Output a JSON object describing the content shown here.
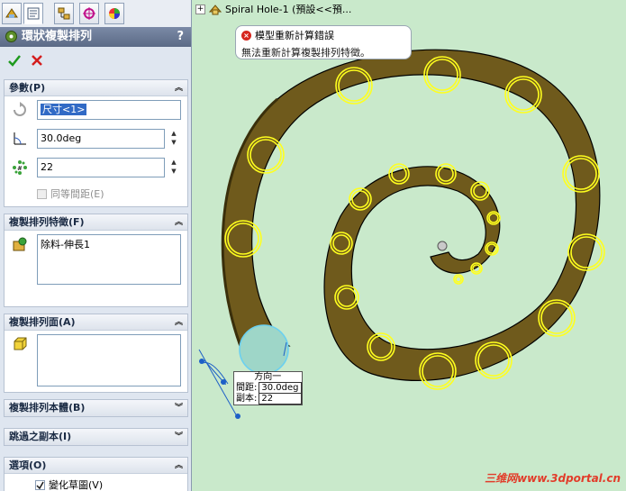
{
  "tabs": [
    {
      "icon": "feature-manager-icon"
    },
    {
      "icon": "property-manager-icon"
    },
    {
      "icon": "configuration-manager-icon"
    },
    {
      "icon": "dimxpert-icon"
    },
    {
      "icon": "display-manager-icon"
    }
  ],
  "panel": {
    "title": "環狀複製排列",
    "help": "?"
  },
  "groups": {
    "parameters": {
      "title": "參數(P)",
      "axis_value": "尺寸<1>",
      "angle_value": "30.0deg",
      "instances_value": "22",
      "equal_spacing_label": "同等間距(E)"
    },
    "features": {
      "title": "複製排列特徵(F)",
      "items": [
        "除料-伸長1"
      ]
    },
    "faces": {
      "title": "複製排列面(A)"
    },
    "bodies": {
      "title": "複製排列本體(B)"
    },
    "skip": {
      "title": "跳過之副本(I)"
    },
    "options": {
      "title": "選項(O)",
      "vary_sketch_label": "變化草圖(V)"
    }
  },
  "graphics": {
    "tree_label": "Spiral Hole-1 (預設<<預...",
    "tooltip_title": "模型重新計算錯誤",
    "tooltip_message": "無法重新計算複製排列特徵。",
    "dim_header": "方向一",
    "dim_spacing_label": "間距:",
    "dim_spacing_value": "30.0deg",
    "dim_copies_label": "副本:",
    "dim_copies_value": "22",
    "watermark": "三维网www.3dportal.cn"
  },
  "colors": {
    "spiral_fill": "#6f5a1c",
    "hole_outline": "#ffff1e",
    "background": "#c9e9cb",
    "accent_error": "#d6261e"
  }
}
